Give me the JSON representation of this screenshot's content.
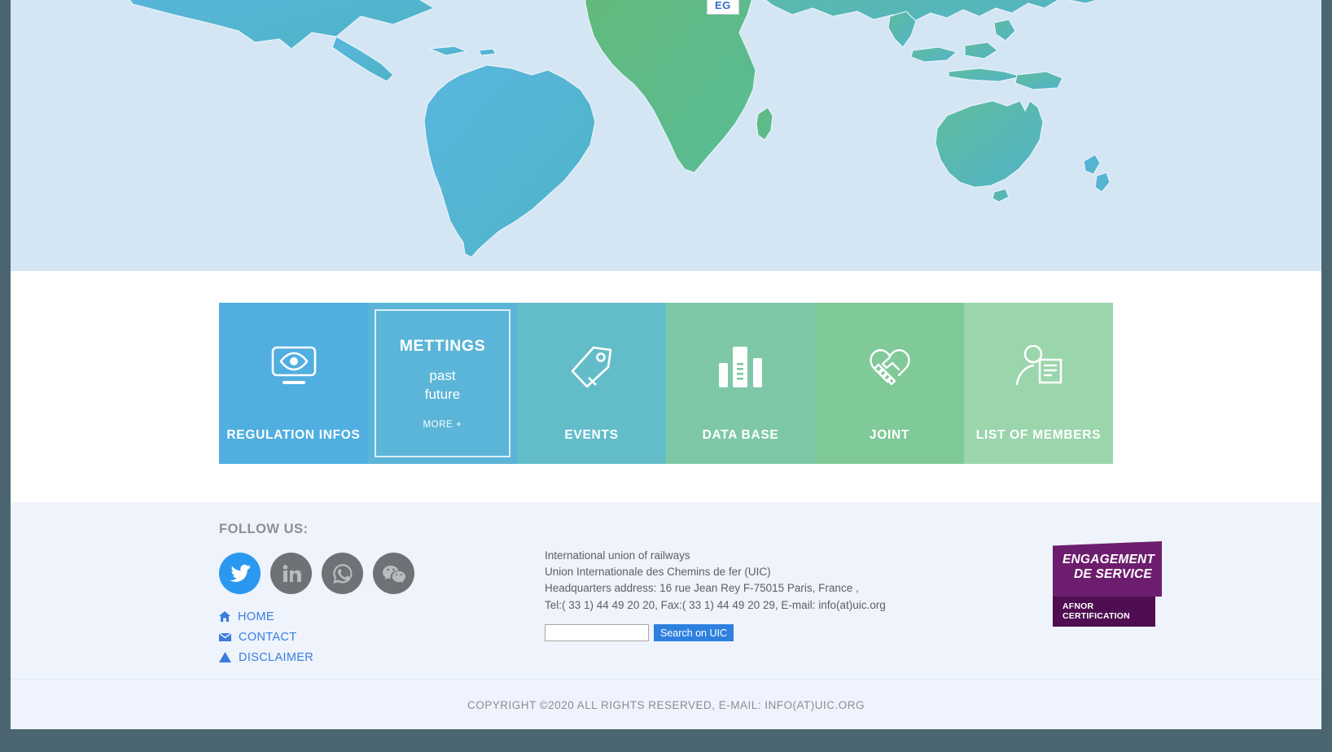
{
  "map": {
    "tooltip_label": "EG",
    "ocean_color": "#d4e6f4",
    "americas_color": "#56b0d8",
    "africa_color": "#68b97e",
    "asia_color": "#5fb9c4"
  },
  "tiles": [
    {
      "label": "REGULATION INFOS",
      "icon": "eye-monitor-icon",
      "color": "#51aee0"
    },
    {
      "label": "METTINGS",
      "icon": "none",
      "color": "#5bb5d8",
      "sub1": "past",
      "sub2": "future",
      "more": "MORE +"
    },
    {
      "label": "EVENTS",
      "icon": "tag-icon",
      "color": "#63bdc9"
    },
    {
      "label": "DATA BASE",
      "icon": "bar-chart-icon",
      "color": "#7ec8a7"
    },
    {
      "label": "JOINT",
      "icon": "handshake-heart-icon",
      "color": "#80c998"
    },
    {
      "label": "LIST OF MEMBERS",
      "icon": "person-document-icon",
      "color": "#9bd5ac"
    }
  ],
  "footer": {
    "follow_us": "FOLLOW US:",
    "social": [
      {
        "name": "twitter",
        "color": "#2b98ef"
      },
      {
        "name": "linkedin",
        "color": "#6e7276"
      },
      {
        "name": "whatsapp",
        "color": "#6e7276"
      },
      {
        "name": "wechat",
        "color": "#6e7276"
      }
    ],
    "links": [
      {
        "label": "HOME",
        "icon": "home-icon"
      },
      {
        "label": "CONTACT",
        "icon": "envelope-icon"
      },
      {
        "label": "DISCLAIMER",
        "icon": "warning-triangle-icon"
      }
    ],
    "contact": {
      "line1": "International union of railways",
      "line2": "Union Internationale des Chemins de fer (UIC)",
      "line3": "Headquarters address: 16 rue Jean Rey F-75015 Paris, France ,",
      "line4": "Tel:( 33 1) 44 49 20 20, Fax:( 33 1) 44 49 20 29, E-mail: info(at)uic.org"
    },
    "search": {
      "value": "",
      "placeholder": "",
      "button_label": "Search on UIC",
      "button_color": "#2e80e0"
    },
    "afnor": {
      "line1": "ENGAGEMENT",
      "line2": "DE SERVICE",
      "line3": "AFNOR CERTIFICATION",
      "color": "#6d1d6e"
    }
  },
  "copyright": {
    "text": "COPYRIGHT ©2020  ALL RIGHTS RESERVED, E-MAIL: INFO(AT)UIC.ORG"
  }
}
